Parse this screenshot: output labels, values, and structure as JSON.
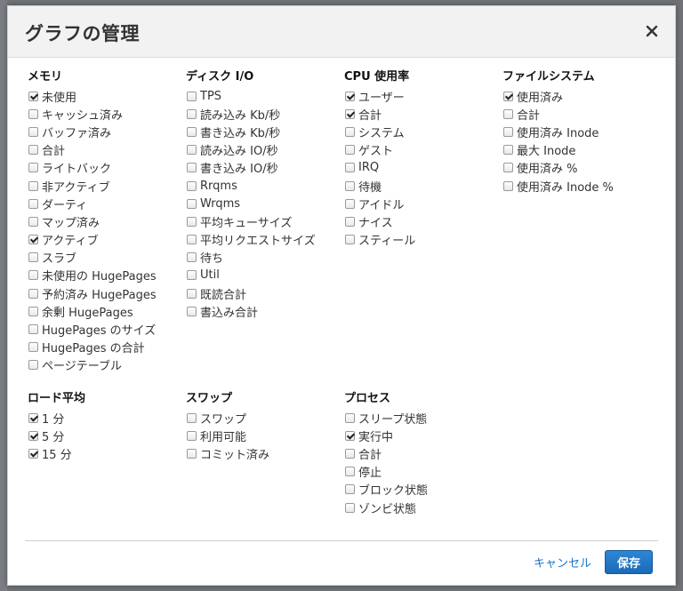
{
  "dialog": {
    "title": "グラフの管理",
    "close_label": "×"
  },
  "groups": {
    "memory": {
      "title": "メモリ",
      "items": [
        {
          "label": "未使用",
          "checked": true
        },
        {
          "label": "キャッシュ済み",
          "checked": false
        },
        {
          "label": "バッファ済み",
          "checked": false
        },
        {
          "label": "合計",
          "checked": false
        },
        {
          "label": "ライトバック",
          "checked": false
        },
        {
          "label": "非アクティブ",
          "checked": false
        },
        {
          "label": "ダーティ",
          "checked": false
        },
        {
          "label": "マップ済み",
          "checked": false
        },
        {
          "label": "アクティブ",
          "checked": true
        },
        {
          "label": "スラブ",
          "checked": false
        },
        {
          "label": "未使用の HugePages",
          "checked": false
        },
        {
          "label": "予約済み HugePages",
          "checked": false
        },
        {
          "label": "余剰 HugePages",
          "checked": false
        },
        {
          "label": "HugePages のサイズ",
          "checked": false
        },
        {
          "label": "HugePages の合計",
          "checked": false
        },
        {
          "label": "ページテーブル",
          "checked": false
        }
      ]
    },
    "disk": {
      "title": "ディスク I/O",
      "items": [
        {
          "label": "TPS",
          "checked": false
        },
        {
          "label": "読み込み Kb/秒",
          "checked": false
        },
        {
          "label": "書き込み Kb/秒",
          "checked": false
        },
        {
          "label": "読み込み IO/秒",
          "checked": false
        },
        {
          "label": "書き込み IO/秒",
          "checked": false
        },
        {
          "label": "Rrqms",
          "checked": false
        },
        {
          "label": "Wrqms",
          "checked": false
        },
        {
          "label": "平均キューサイズ",
          "checked": false
        },
        {
          "label": "平均リクエストサイズ",
          "checked": false
        },
        {
          "label": "待ち",
          "checked": false
        },
        {
          "label": "Util",
          "checked": false
        },
        {
          "label": "既読合計",
          "checked": false
        },
        {
          "label": "書込み合計",
          "checked": false
        }
      ]
    },
    "cpu": {
      "title": "CPU 使用率",
      "items": [
        {
          "label": "ユーザー",
          "checked": true
        },
        {
          "label": "合計",
          "checked": true
        },
        {
          "label": "システム",
          "checked": false
        },
        {
          "label": "ゲスト",
          "checked": false
        },
        {
          "label": "IRQ",
          "checked": false
        },
        {
          "label": "待機",
          "checked": false
        },
        {
          "label": "アイドル",
          "checked": false
        },
        {
          "label": "ナイス",
          "checked": false
        },
        {
          "label": "スティール",
          "checked": false
        }
      ]
    },
    "filesystem": {
      "title": "ファイルシステム",
      "items": [
        {
          "label": "使用済み",
          "checked": true
        },
        {
          "label": "合計",
          "checked": false
        },
        {
          "label": "使用済み Inode",
          "checked": false
        },
        {
          "label": "最大 Inode",
          "checked": false
        },
        {
          "label": "使用済み %",
          "checked": false
        },
        {
          "label": "使用済み Inode %",
          "checked": false
        }
      ]
    },
    "load": {
      "title": "ロード平均",
      "items": [
        {
          "label": "1 分",
          "checked": true
        },
        {
          "label": "5 分",
          "checked": true
        },
        {
          "label": "15 分",
          "checked": true
        }
      ]
    },
    "swap": {
      "title": "スワップ",
      "items": [
        {
          "label": "スワップ",
          "checked": false
        },
        {
          "label": "利用可能",
          "checked": false
        },
        {
          "label": "コミット済み",
          "checked": false
        }
      ]
    },
    "process": {
      "title": "プロセス",
      "items": [
        {
          "label": "スリープ状態",
          "checked": false
        },
        {
          "label": "実行中",
          "checked": true
        },
        {
          "label": "合計",
          "checked": false
        },
        {
          "label": "停止",
          "checked": false
        },
        {
          "label": "ブロック状態",
          "checked": false
        },
        {
          "label": "ゾンビ状態",
          "checked": false
        }
      ]
    }
  },
  "footer": {
    "cancel_label": "キャンセル",
    "save_label": "保存"
  },
  "colors": {
    "accent": "#1b6bb8",
    "link": "#1a73c5",
    "header_bg": "#f2f2f2"
  }
}
